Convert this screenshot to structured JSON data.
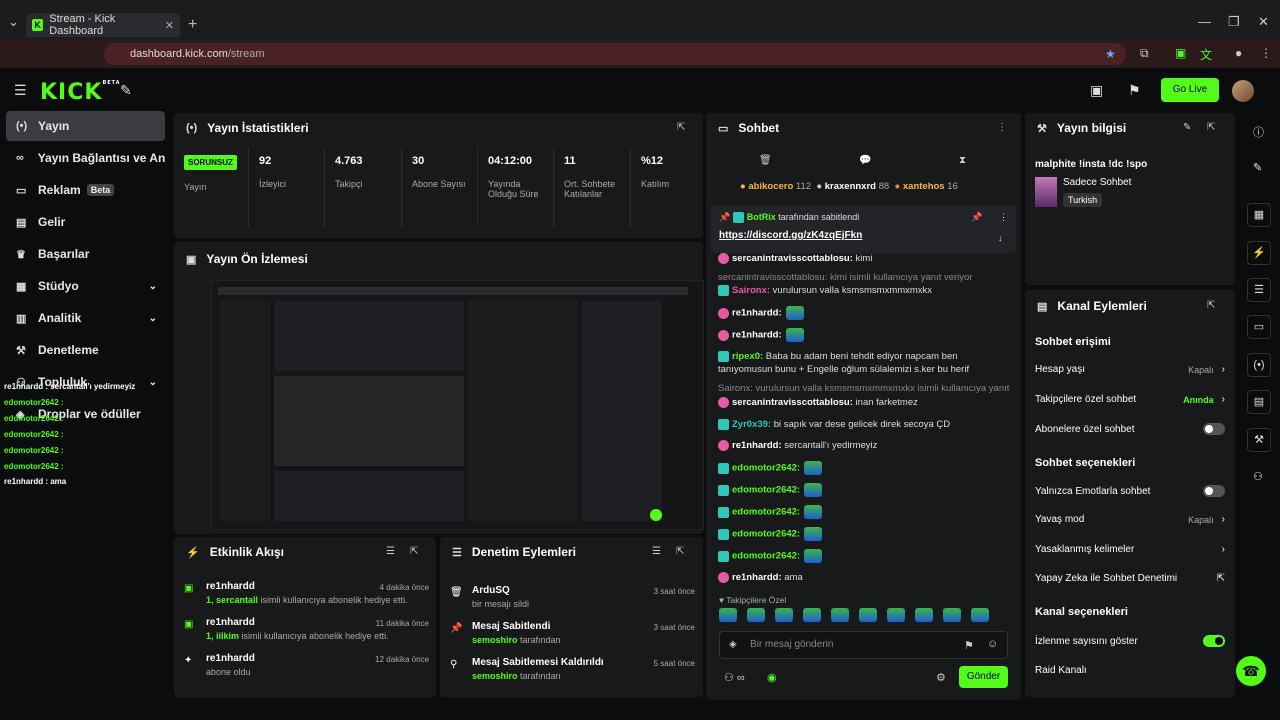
{
  "browser": {
    "tab_title": "Stream - Kick Dashboard",
    "url_host": "dashboard.kick.com",
    "url_path": "/stream"
  },
  "header": {
    "logo": "KICK",
    "logo_badge": "BETA",
    "go_live": "Go Live"
  },
  "sidebar": {
    "items": [
      {
        "label": "Yayın",
        "icon": "broadcast-icon"
      },
      {
        "label": "Yayın Bağlantısı ve Anahtar",
        "icon": "link-icon"
      },
      {
        "label": "Reklam",
        "icon": "ad-icon",
        "badge": "Beta"
      },
      {
        "label": "Gelir",
        "icon": "revenue-icon"
      },
      {
        "label": "Başarılar",
        "icon": "trophy-icon"
      },
      {
        "label": "Stüdyo",
        "icon": "studio-icon"
      },
      {
        "label": "Analitik",
        "icon": "analytics-icon"
      },
      {
        "label": "Denetleme",
        "icon": "moderation-icon"
      },
      {
        "label": "Topluluk",
        "icon": "community-icon"
      },
      {
        "label": "Droplar ve ödüller",
        "icon": "drops-icon"
      }
    ]
  },
  "overlay_chat": [
    "re1nhardd : sercantall'ı yedirmeyiz",
    "edomotor2642 :",
    "edomotor2642 :",
    "edomotor2642 :",
    "edomotor2642 :",
    "edomotor2642 :",
    "re1nhardd : ama"
  ],
  "stats": {
    "title": "Yayın İstatistikleri",
    "status_badge": "SORUNSUZ",
    "status_label": "Yayın",
    "cells": [
      {
        "value": "92",
        "label": "İzleyici"
      },
      {
        "value": "4.763",
        "label": "Takipçi"
      },
      {
        "value": "30",
        "label": "Abone Sayısı"
      },
      {
        "value": "04:12:00",
        "label": "Yayında Olduğu Süre"
      },
      {
        "value": "11",
        "label": "Ort. Sohbete Katılanlar"
      },
      {
        "value": "%12",
        "label": "Katılım"
      }
    ]
  },
  "preview": {
    "title": "Yayın Ön İzlemesi"
  },
  "activity": {
    "title": "Etkinlik Akışı",
    "items": [
      {
        "name": "re1nhardd",
        "time": "4 dakika önce",
        "highlight": "1, sercantall",
        "text": " isimli kullanıcıya abonelik hediye etti."
      },
      {
        "name": "re1nhardd",
        "time": "11 dakika önce",
        "highlight": "1, iilkim",
        "text": " isimli kullanıcıya abonelik hediye etti."
      },
      {
        "name": "re1nhardd",
        "time": "12 dakika önce",
        "highlight": "",
        "text": "abone oldu"
      }
    ]
  },
  "modlog": {
    "title": "Denetim Eylemleri",
    "items": [
      {
        "title": "ArduSQ",
        "sub": "bir mesajı sildi",
        "time": "3 saat önce",
        "icon": "trash-icon"
      },
      {
        "title": "Mesaj Sabitlendi",
        "sub": "semoshiro",
        "sub2": " tarafından",
        "time": "3 saat önce",
        "icon": "pin-icon"
      },
      {
        "title": "Mesaj Sabitlemesi Kaldırıldı",
        "sub": "semoshiro",
        "sub2": " tarafından",
        "time": "5 saat önce",
        "icon": "unpin-icon"
      }
    ]
  },
  "chat": {
    "title": "Sohbet",
    "top": [
      {
        "name": "abikocero",
        "count": "112"
      },
      {
        "name": "kraxennxrd",
        "count": "88"
      },
      {
        "name": "xantehos",
        "count": "16"
      }
    ],
    "pinned": {
      "by": "BotRix",
      "by_suffix": "tarafından sabitlendi",
      "link": "https://discord.gg/zK4zqEjFkn"
    },
    "messages": [
      {
        "user": "sercanintravisscottablosu:",
        "text": " kimi",
        "color": "#fff"
      },
      {
        "user": "",
        "text": "sercanintravisscottablosu: kimi isimli kullanıcıya yanıt veriyor",
        "sys": true
      },
      {
        "user": "Saironx:",
        "text": " vurulursun valla ksmsmsmxmmxmxkx",
        "color": "#e85aa0"
      },
      {
        "user": "re1nhardd:",
        "text": "",
        "color": "#fff",
        "emote": true
      },
      {
        "user": "re1nhardd:",
        "text": "",
        "color": "#fff",
        "emote": true
      },
      {
        "user": "ripex0:",
        "text": " Baba bu adam beni tehdit ediyor napcam ben tanıyomusun bunu + Engelle oğlum sülalemizi s.ker bu herif",
        "color": "#53fc18"
      },
      {
        "user": "",
        "text": "Saironx: vurulursun valla ksmsmsmxmmxmxkx isimli kullanıcıya yanıt ...",
        "sys": true
      },
      {
        "user": "sercanintravisscottablosu:",
        "text": " inan farketmez",
        "color": "#fff"
      },
      {
        "user": "Zyr0x39:",
        "text": " bi sapık var dese gelicek direk secoya ÇD",
        "color": "#2fc7b8"
      },
      {
        "user": "re1nhardd:",
        "text": " sercantall'ı yedirmeyiz",
        "color": "#fff"
      },
      {
        "user": "edomotor2642:",
        "text": "",
        "color": "#53fc18",
        "emote": true
      },
      {
        "user": "edomotor2642:",
        "text": "",
        "color": "#53fc18",
        "emote": true
      },
      {
        "user": "edomotor2642:",
        "text": "",
        "color": "#53fc18",
        "emote": true
      },
      {
        "user": "edomotor2642:",
        "text": "",
        "color": "#53fc18",
        "emote": true
      },
      {
        "user": "edomotor2642:",
        "text": "",
        "color": "#53fc18",
        "emote": true
      },
      {
        "user": "re1nhardd:",
        "text": " ama",
        "color": "#fff"
      }
    ],
    "follower_only": "Takipçilere Özel",
    "input_placeholder": "Bir mesaj gönderin",
    "send": "Gönder"
  },
  "info": {
    "title": "Yayın bilgisi",
    "stream_title": "malphite !insta !dc !spo",
    "category": "Sadece Sohbet",
    "tag": "Turkish"
  },
  "channel": {
    "title": "Kanal Eylemleri",
    "sec1": "Sohbet erişimi",
    "rows1": [
      {
        "label": "Hesap yaşı",
        "value": "Kapalı",
        "kind": "chev"
      },
      {
        "label": "Takipçilere özel sohbet",
        "value": "Anında",
        "kind": "chevg"
      },
      {
        "label": "Abonelere özel sohbet",
        "value": "",
        "kind": "off"
      }
    ],
    "sec2": "Sohbet seçenekleri",
    "rows2": [
      {
        "label": "Yalnızca Emotlarla sohbet",
        "value": "",
        "kind": "off"
      },
      {
        "label": "Yavaş mod",
        "value": "Kapalı",
        "kind": "chev"
      },
      {
        "label": "Yasaklanmış kelimeler",
        "value": "",
        "kind": "chev"
      },
      {
        "label": "Yapay Zeka ile Sohbet Denetimi",
        "value": "",
        "kind": "ext"
      }
    ],
    "sec3": "Kanal seçenekleri",
    "rows3": [
      {
        "label": "İzlenme sayısını göster",
        "value": "",
        "kind": "on"
      },
      {
        "label": "Raid Kanalı",
        "value": "",
        "kind": "none"
      }
    ]
  },
  "colors": {
    "accent": "#53fc18",
    "panel": "#18191b",
    "bg": "#0b0c0d"
  }
}
